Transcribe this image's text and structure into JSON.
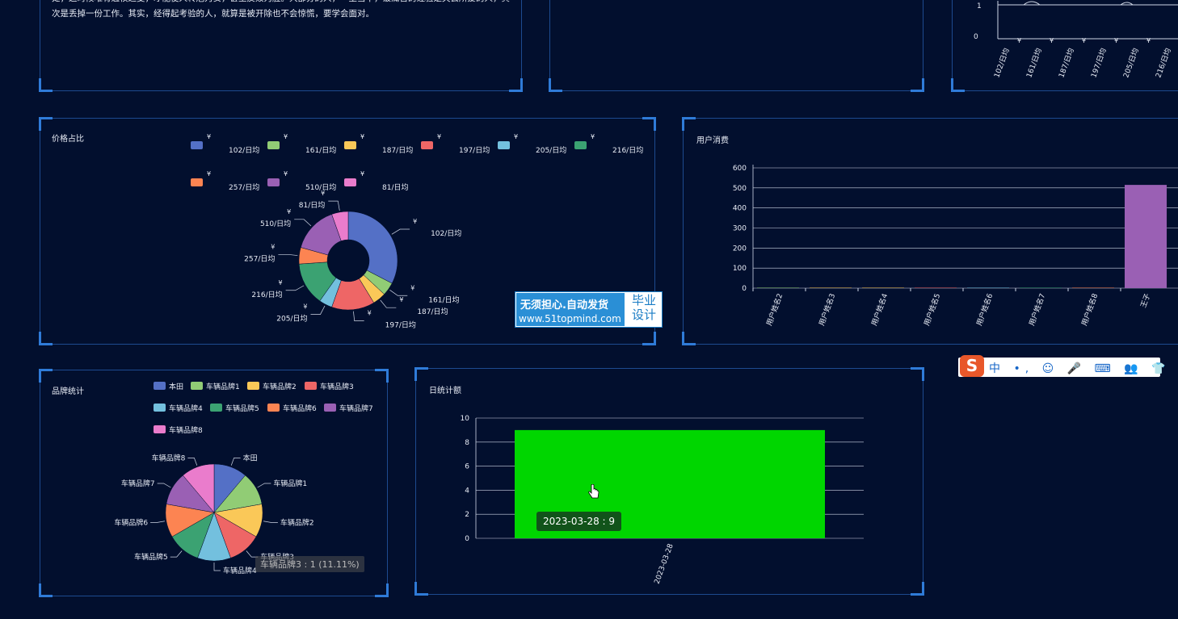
{
  "intro_panel": {
    "text": "处，这时候唯有通权达变，才能使人转危为安，甚至反败为胜。大部分的人，一生当中，最痛苦的经验是失去所爱的人，其次是丢掉一份工作。其实，经得起考验的人，就算是被开除也不会惊慌，要学会面对。"
  },
  "top_right_chart": {
    "yticks": [
      "1",
      "0"
    ],
    "xticks": [
      "102/日均",
      "161/日均",
      "187/日均",
      "197/日均",
      "205/日均",
      "216/日均"
    ],
    "currency": "¥"
  },
  "price_panel": {
    "title": "价格占比",
    "chart_data": {
      "type": "pie",
      "variant": "donut",
      "currency_symbol": "¥",
      "categories": [
        "102/日均",
        "161/日均",
        "187/日均",
        "197/日均",
        "205/日均",
        "216/日均",
        "257/日均",
        "510/日均",
        "81/日均"
      ],
      "values": [
        30,
        4,
        4,
        13,
        4,
        13,
        5,
        14,
        5
      ],
      "colors": [
        "#5470c6",
        "#91cc75",
        "#fac858",
        "#ee6666",
        "#73c0de",
        "#3ba272",
        "#fc8452",
        "#9a60b4",
        "#ea7ccc"
      ]
    }
  },
  "user_panel": {
    "title": "用户消费",
    "chart_data": {
      "type": "bar",
      "categories": [
        "用户姓名2",
        "用户姓名3",
        "用户姓名4",
        "用户姓名5",
        "用户姓名6",
        "用户姓名7",
        "用户姓名8",
        "王子"
      ],
      "values": [
        2,
        2,
        2,
        2,
        2,
        2,
        2,
        515
      ],
      "colors": [
        "#91cc75",
        "#fac858",
        "#fac858",
        "#ee6666",
        "#73c0de",
        "#3ba272",
        "#fc8452",
        "#9a60b4"
      ],
      "ylim": [
        0,
        600
      ],
      "yticks": [
        0,
        100,
        200,
        300,
        400,
        500,
        600
      ]
    }
  },
  "brand_panel": {
    "title": "品牌统计",
    "tooltip": "车辆品牌3 : 1 (11.11%)",
    "chart_data": {
      "type": "pie",
      "categories": [
        "本田",
        "车辆品牌1",
        "车辆品牌2",
        "车辆品牌3",
        "车辆品牌4",
        "车辆品牌5",
        "车辆品牌6",
        "车辆品牌7",
        "车辆品牌8"
      ],
      "values": [
        1,
        1,
        1,
        1,
        1,
        1,
        1,
        1,
        1
      ],
      "colors": [
        "#5470c6",
        "#91cc75",
        "#fac858",
        "#ee6666",
        "#73c0de",
        "#3ba272",
        "#fc8452",
        "#9a60b4",
        "#ea7ccc"
      ]
    }
  },
  "daily_panel": {
    "title": "日统计额",
    "tooltip": "2023-03-28 : 9",
    "chart_data": {
      "type": "bar",
      "categories": [
        "2023-03-28"
      ],
      "values": [
        9
      ],
      "color": "#00d600",
      "ylim": [
        0,
        10
      ],
      "yticks": [
        0,
        2,
        4,
        6,
        8,
        10
      ]
    }
  },
  "watermark": {
    "line1": "无须担心.自动发货",
    "line2": "www.51topmind.com",
    "side1": "毕业",
    "side2": "设计"
  },
  "ime_toolbar": {
    "logo": "S",
    "items": "中 •, ☺ 🎤 ⌨ 👥 👕 简 ▦"
  }
}
